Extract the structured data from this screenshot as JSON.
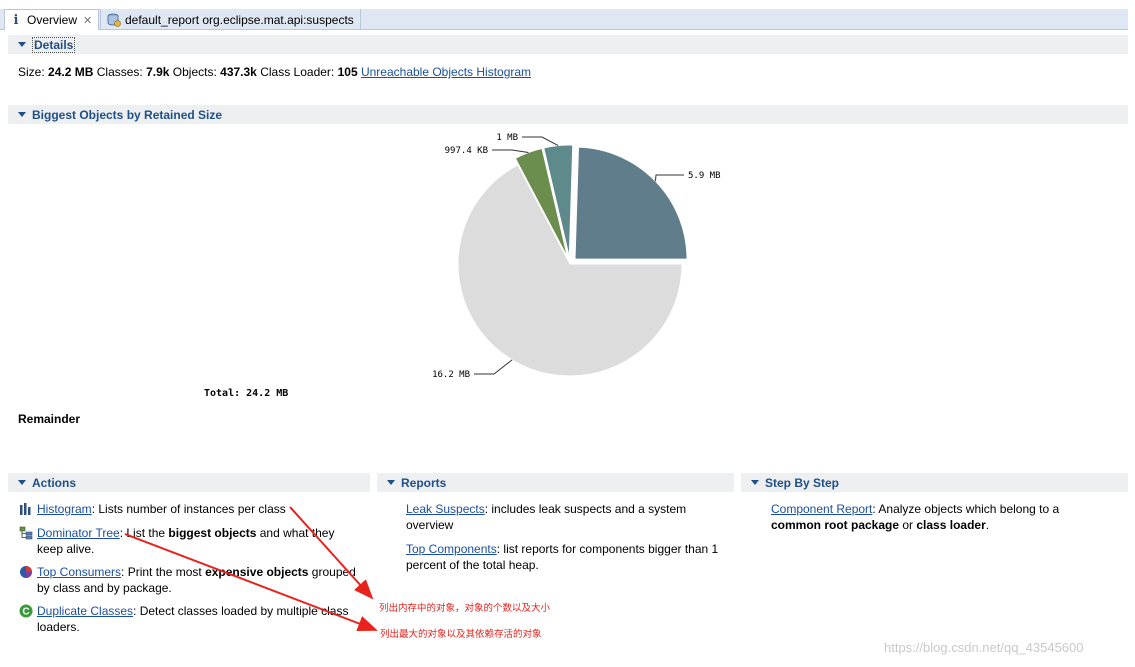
{
  "tabs": [
    {
      "label": "Overview",
      "active": true
    },
    {
      "label": "default_report  org.eclipse.mat.api:suspects",
      "active": false
    }
  ],
  "details": {
    "title": "Details",
    "size_label": "Size:",
    "size_value": "24.2 MB",
    "classes_label": "Classes:",
    "classes_value": "7.9k",
    "objects_label": "Objects:",
    "objects_value": "437.3k",
    "classloader_label": "Class Loader:",
    "classloader_value": "105",
    "histogram_link": "Unreachable Objects Histogram"
  },
  "biggest": {
    "title": "Biggest Objects by Retained Size",
    "total_label": "Total: 24.2 MB",
    "remainder_label": "Remainder"
  },
  "chart_data": {
    "type": "pie",
    "unit": "MB",
    "slices": [
      {
        "label": "5.9 MB",
        "value": 5.9,
        "color": "#607d8b",
        "exploded": true
      },
      {
        "label": "1 MB",
        "value": 1.0,
        "color": "#5f8a8b",
        "exploded": true
      },
      {
        "label": "997.4 KB",
        "value": 0.974,
        "color": "#6b8e4e",
        "exploded": true
      },
      {
        "label": "16.2 MB",
        "value": 16.2,
        "color": "#dcdcdc",
        "exploded": false
      }
    ]
  },
  "actions": {
    "title": "Actions",
    "items": [
      {
        "link": "Histogram",
        "text_before": ": Lists number of instances per class",
        "bold": "",
        "text_after": "",
        "icon": "histogram-icon"
      },
      {
        "link": "Dominator Tree",
        "text_before": ": List the ",
        "bold": "biggest objects",
        "text_after": " and what they keep alive.",
        "icon": "dominator-tree-icon"
      },
      {
        "link": "Top Consumers",
        "text_before": ": Print the most ",
        "bold": "expensive objects",
        "text_after": " grouped by class and by package.",
        "icon": "top-consumers-icon"
      },
      {
        "link": "Duplicate Classes",
        "text_before": ": Detect classes loaded by multiple class loaders.",
        "bold": "",
        "text_after": "",
        "icon": "duplicate-classes-icon"
      }
    ]
  },
  "reports": {
    "title": "Reports",
    "items": [
      {
        "link": "Leak Suspects",
        "text": ": includes leak suspects and a system overview"
      },
      {
        "link": "Top Components",
        "text": ": list reports for components bigger than 1 percent of the total heap."
      }
    ]
  },
  "stepbystep": {
    "title": "Step By Step",
    "link": "Component Report",
    "text1": ": Analyze objects which belong to a",
    "bold1": "common root package",
    "text2": " or ",
    "bold2": "class loader",
    "text3": "."
  },
  "annotations": {
    "note1": "列出内存中的对象，对象的个数以及大小",
    "note2": "列出最大的对象以及其依赖存活的对象"
  },
  "watermark": "https://blog.csdn.net/qq_43545600"
}
